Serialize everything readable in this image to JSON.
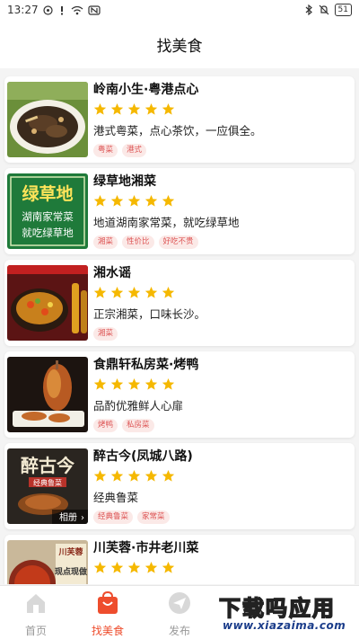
{
  "status": {
    "time": "13:27",
    "battery": "51"
  },
  "header": {
    "title": "找美食"
  },
  "restaurants": [
    {
      "name": "岭南小生·粤港点心",
      "rating": 5,
      "desc": "港式粤菜，点心茶饮，一应俱全。",
      "tags": [
        "粤菜",
        "港式"
      ]
    },
    {
      "name": "绿草地湘菜",
      "rating": 5,
      "desc": "地道湖南家常菜，就吃绿草地",
      "tags": [
        "湘菜",
        "性价比",
        "好吃不贵"
      ],
      "thumb_text": [
        "绿草地",
        "湖南家常菜",
        "就吃绿草地"
      ]
    },
    {
      "name": "湘水谣",
      "rating": 5,
      "desc": "正宗湘菜，口味长沙。",
      "tags": [
        "湘菜"
      ]
    },
    {
      "name": "食鼎轩私房菜·烤鸭",
      "rating": 5,
      "desc": "品酌优雅鲜人心扉",
      "tags": [
        "烤鸭",
        "私房菜"
      ]
    },
    {
      "name": "醉古今(凤城八路)",
      "rating": 5,
      "desc": "经典鲁菜",
      "tags": [
        "经典鲁菜",
        "家常菜"
      ],
      "thumb_text": [
        "醉古今",
        "经典鲁菜",
        "相册"
      ]
    },
    {
      "name": "川芙蓉·市井老川菜",
      "rating": 5,
      "desc": "",
      "tags": [],
      "thumb_text": [
        "川芙蓉",
        "现点现做"
      ]
    }
  ],
  "tabbar": {
    "tabs": [
      "首页",
      "找美食",
      "发布"
    ],
    "active": 1
  },
  "watermark": {
    "main": "下载吗应用",
    "sub": "www.xiazaima.com"
  },
  "colors": {
    "accent": "#ee4d2d",
    "star": "#f5b800",
    "tag_bg": "#fbe9e7",
    "tag_text": "#dd5555"
  }
}
